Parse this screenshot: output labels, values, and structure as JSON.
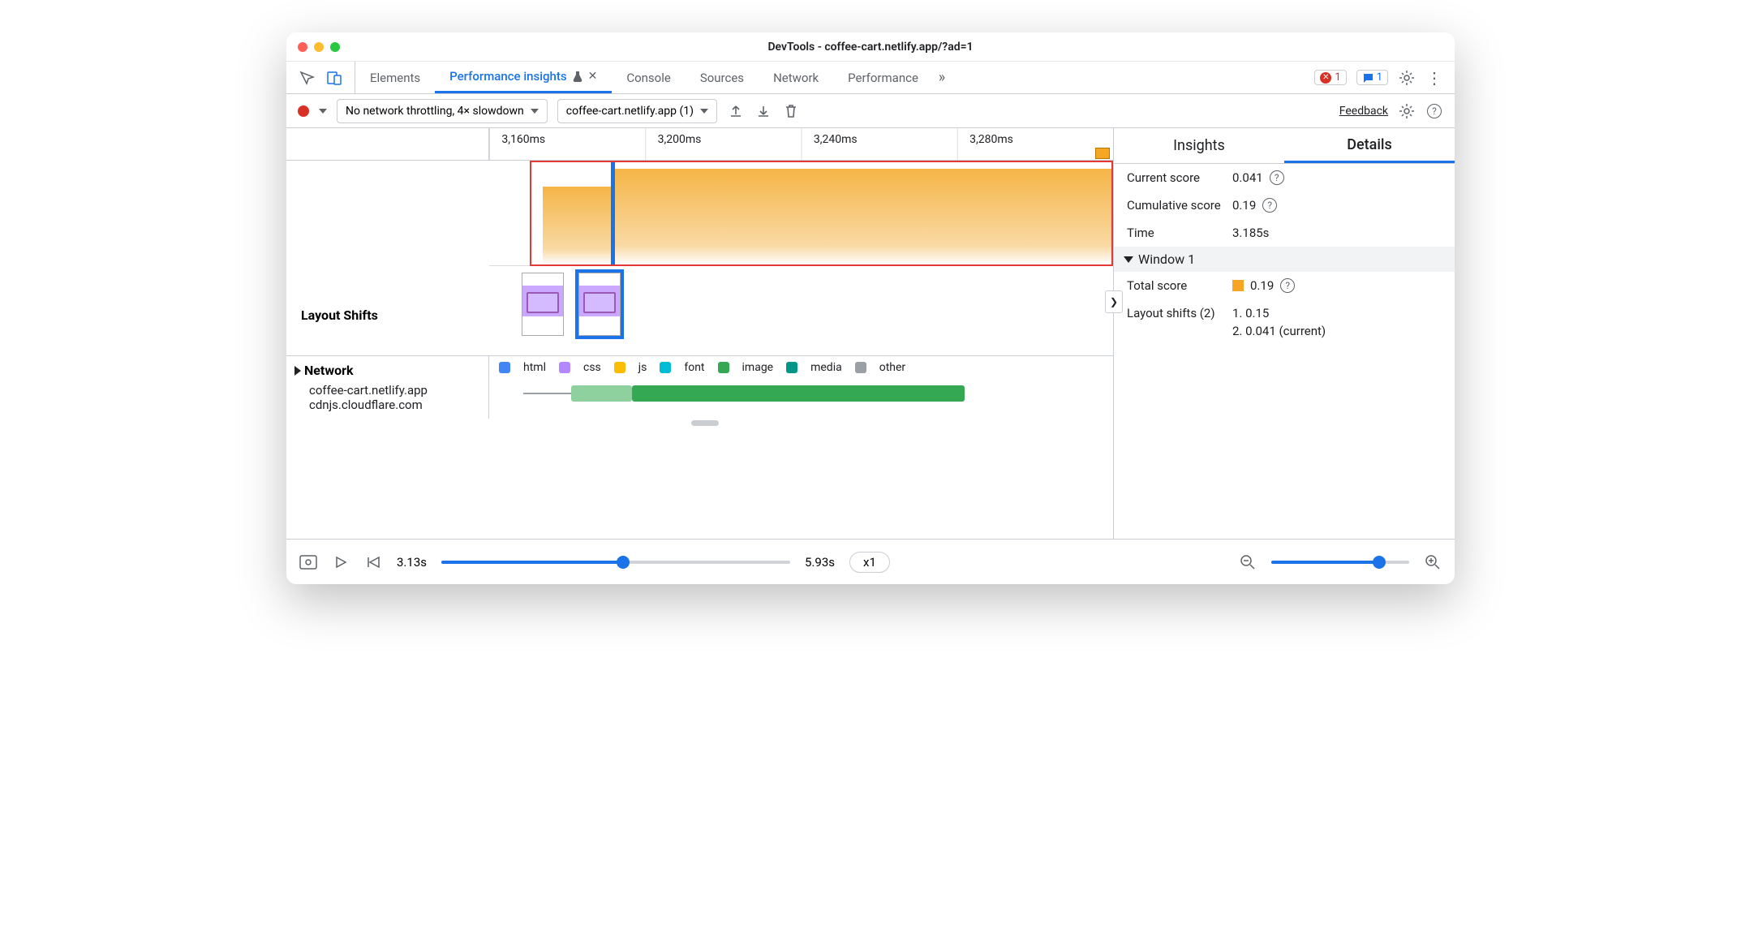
{
  "window": {
    "title": "DevTools - coffee-cart.netlify.app/?ad=1"
  },
  "tabs": {
    "elements": "Elements",
    "perf_insights": "Performance insights",
    "console": "Console",
    "sources": "Sources",
    "network": "Network",
    "performance": "Performance",
    "errors_count": "1",
    "info_count": "1"
  },
  "perf_bar": {
    "throttling": "No network throttling, 4× slowdown",
    "recording": "coffee-cart.netlify.app (1)",
    "feedback": "Feedback"
  },
  "ruler": {
    "ticks": [
      "3,160ms",
      "3,200ms",
      "3,240ms",
      "3,280ms"
    ]
  },
  "layout_shifts": {
    "label": "Layout Shifts"
  },
  "network": {
    "header": "Network",
    "domains": [
      "coffee-cart.netlify.app",
      "cdnjs.cloudflare.com"
    ],
    "legend": {
      "html": "html",
      "css": "css",
      "js": "js",
      "font": "font",
      "image": "image",
      "media": "media",
      "other": "other"
    }
  },
  "right": {
    "insights": "Insights",
    "details": "Details",
    "current_score_k": "Current score",
    "current_score_v": "0.041",
    "cum_score_k": "Cumulative score",
    "cum_score_v": "0.19",
    "time_k": "Time",
    "time_v": "3.185s",
    "window1": "Window 1",
    "total_score_k": "Total score",
    "total_score_v": "0.19",
    "ls_k": "Layout shifts (2)",
    "ls_1": "1. 0.15",
    "ls_2": "2. 0.041 (current)"
  },
  "footer": {
    "start": "3.13s",
    "end": "5.93s",
    "speed": "x1"
  },
  "colors": {
    "html": "#4285f4",
    "css": "#b388ff",
    "js": "#fbbc04",
    "font": "#00bcd4",
    "image": "#34a853",
    "media": "#009688",
    "other": "#9aa0a6"
  }
}
